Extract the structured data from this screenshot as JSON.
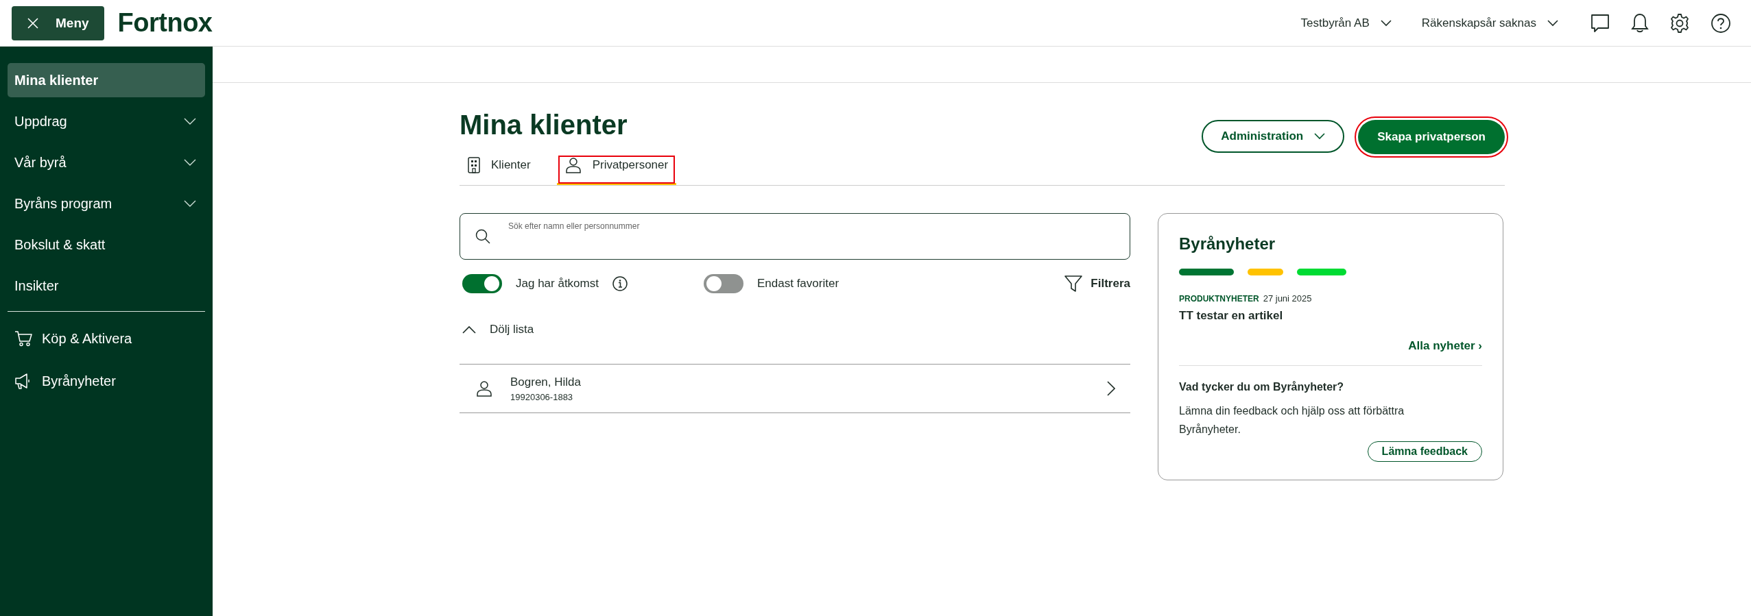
{
  "header": {
    "menu_button": "Meny",
    "logo": "Fortnox",
    "selectors": [
      {
        "label": "Testbyrån AB"
      },
      {
        "label": "Räkenskapsår saknas"
      }
    ]
  },
  "sidebar": {
    "items": [
      {
        "label": "Mina klienter",
        "selected": true,
        "kind": "link"
      },
      {
        "label": "Uppdrag",
        "selected": false,
        "kind": "group",
        "expanded": false
      },
      {
        "label": "Vår byrå",
        "selected": false,
        "kind": "group",
        "expanded": false
      },
      {
        "label": "Byråns program",
        "selected": false,
        "kind": "group",
        "expanded": false
      },
      {
        "label": "Bokslut & skatt",
        "selected": false,
        "kind": "link"
      },
      {
        "label": "Insikter",
        "selected": false,
        "kind": "link"
      }
    ],
    "footer_items": [
      {
        "label": "Köp & Aktivera"
      },
      {
        "label": "Byrånyheter"
      }
    ]
  },
  "page": {
    "title": "Mina klienter",
    "admin_button": "Administration",
    "create_button": {
      "label": "Skapa privatperson",
      "highlighted": true
    },
    "tabs": [
      {
        "label": "Klienter",
        "selected": false,
        "highlighted": false
      },
      {
        "label": "Privatpersoner",
        "selected": true,
        "highlighted": true
      }
    ],
    "search": {
      "placeholder": "Sök efter namn eller personnummer"
    },
    "toggles": [
      {
        "label": "Jag har åtkomst",
        "on": true,
        "info": true
      },
      {
        "label": "Endast favoriter",
        "on": false,
        "info": false
      }
    ],
    "filter": "Filtrera",
    "list_toggle": {
      "label": "Dölj lista",
      "expanded": true
    },
    "clients": [
      {
        "name": "Bogren, Hilda",
        "id_number": "19920306-1883"
      }
    ]
  },
  "news_card": {
    "title": "Byrånyheter",
    "bars": [
      {
        "color": "#007533"
      },
      {
        "color": "#ffc200"
      },
      {
        "color": "#00db33"
      }
    ],
    "article": {
      "category": "PRODUKTNYHETER",
      "date": "27 juni 2025",
      "title": "TT testar en artikel"
    },
    "all_news_link": "Alla nyheter ›",
    "feedback": {
      "question": "Vad tycker du om Byrånyheter?",
      "text": "Lämna din feedback och hjälp oss att förbättra Byrånyheter.",
      "button": "Lämna feedback"
    }
  }
}
